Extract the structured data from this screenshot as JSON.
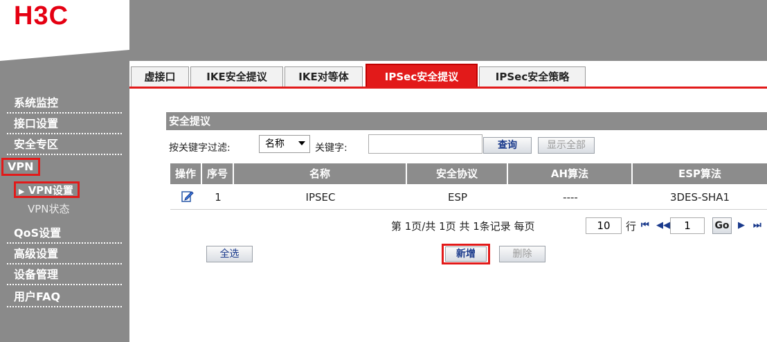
{
  "logo": {
    "text": "H3C",
    "color": "#e50012"
  },
  "sidebar": {
    "items": [
      {
        "label": "系统监控"
      },
      {
        "label": "接口设置"
      },
      {
        "label": "安全专区"
      },
      {
        "label": "VPN"
      },
      {
        "label": "QoS设置"
      },
      {
        "label": "高级设置"
      },
      {
        "label": "设备管理"
      },
      {
        "label": "用户FAQ"
      }
    ],
    "vpn_sub": [
      {
        "label": "VPN设置",
        "arrow": "▶"
      },
      {
        "label": "VPN状态"
      }
    ]
  },
  "tabs": [
    {
      "label": "虚接口"
    },
    {
      "label": "IKE安全提议"
    },
    {
      "label": "IKE对等体"
    },
    {
      "label": "IPSec安全提议",
      "active": true
    },
    {
      "label": "IPSec安全策略"
    }
  ],
  "section": {
    "title": "安全提议"
  },
  "filter": {
    "label": "按关键字过滤:",
    "select_value": "名称",
    "keyword_label": "关键字:",
    "keyword_value": "",
    "query_label": "查询",
    "show_all_label": "显示全部"
  },
  "table": {
    "columns": [
      "操作",
      "序号",
      "名称",
      "安全协议",
      "AH算法",
      "ESP算法"
    ],
    "rows": [
      {
        "index": "1",
        "name": "IPSEC",
        "protocol": "ESP",
        "ah": "----",
        "esp": "3DES-SHA1",
        "action_icon": "edit-icon"
      }
    ]
  },
  "pager": {
    "text": "第 1页/共 1页 共 1条记录 每页",
    "page_size": "10",
    "row_label": "行",
    "current_page": "1",
    "go_label": "Go",
    "first_icon": "⏮",
    "prev_icon": "◀◀",
    "next_icon": "▶",
    "last_icon": "⏭"
  },
  "actions": {
    "select_all": "全选",
    "add": "新增",
    "delete": "删除"
  },
  "colors": {
    "accent": "#e21a1a",
    "grey": "#8a8a8a"
  }
}
